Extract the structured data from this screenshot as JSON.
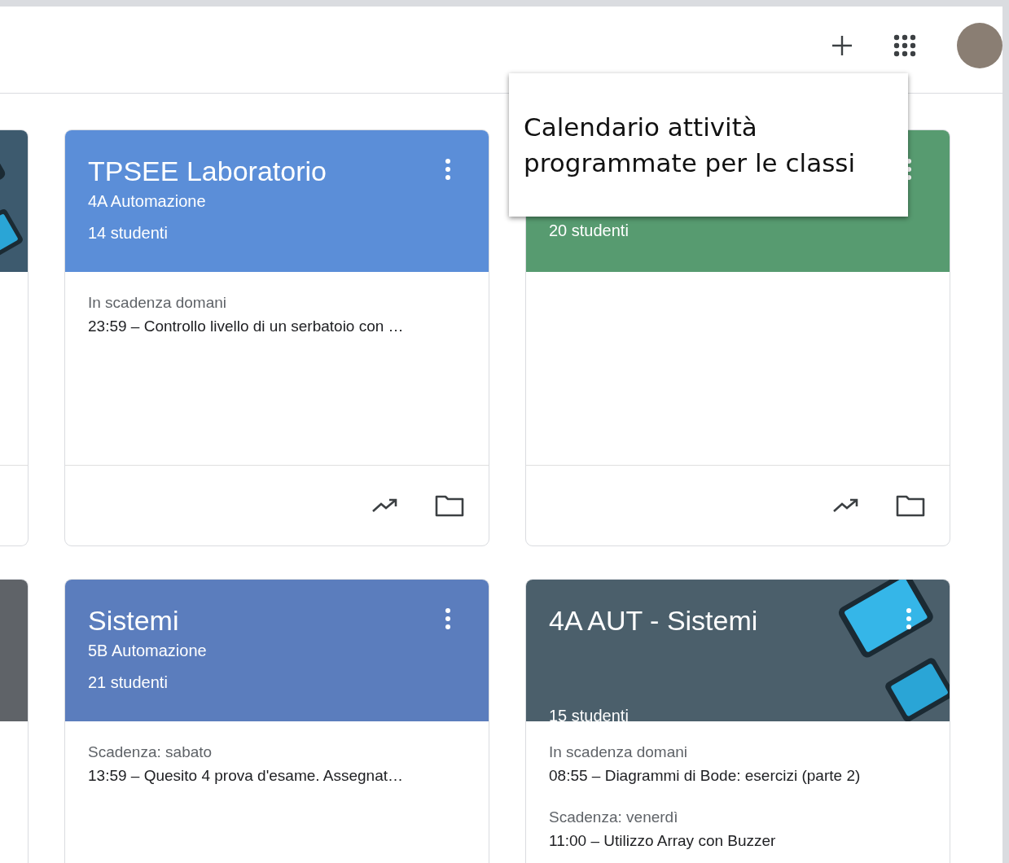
{
  "tooltip": {
    "text": "Calendario attività programmate per le classi"
  },
  "rows": [
    {
      "cards": [
        {
          "kind": "partial",
          "color": "#3d5a6e",
          "illustration": true
        },
        {
          "kind": "full",
          "color": "#5b8ed8",
          "title": "TPSEE Laboratorio",
          "section": "4A Automazione",
          "students": "14 studenti",
          "assignments": [
            {
              "label": "In scadenza domani",
              "text": "23:59 – Controllo livello di un serbatoio con …"
            }
          ]
        },
        {
          "kind": "full",
          "color": "#579b70",
          "students": "20 studenti"
        }
      ]
    },
    {
      "cards": [
        {
          "kind": "partial",
          "color": "#5f6368"
        },
        {
          "kind": "full",
          "color": "#5b7dbd",
          "title": "Sistemi",
          "section": "5B Automazione",
          "students": "21 studenti",
          "assignments": [
            {
              "label": "Scadenza: sabato",
              "text": "13:59 – Quesito 4 prova d'esame. Assegnat…"
            }
          ]
        },
        {
          "kind": "full",
          "color": "#4b5f6b",
          "illustration": true,
          "title": "4A AUT - Sistemi",
          "students": "15 studenti",
          "assignments": [
            {
              "label": "In scadenza domani",
              "text": "08:55 – Diagrammi di Bode: esercizi (parte 2)"
            },
            {
              "label": "Scadenza: venerdì",
              "text": "11:00 – Utilizzo Array con Buzzer"
            }
          ]
        }
      ]
    }
  ]
}
